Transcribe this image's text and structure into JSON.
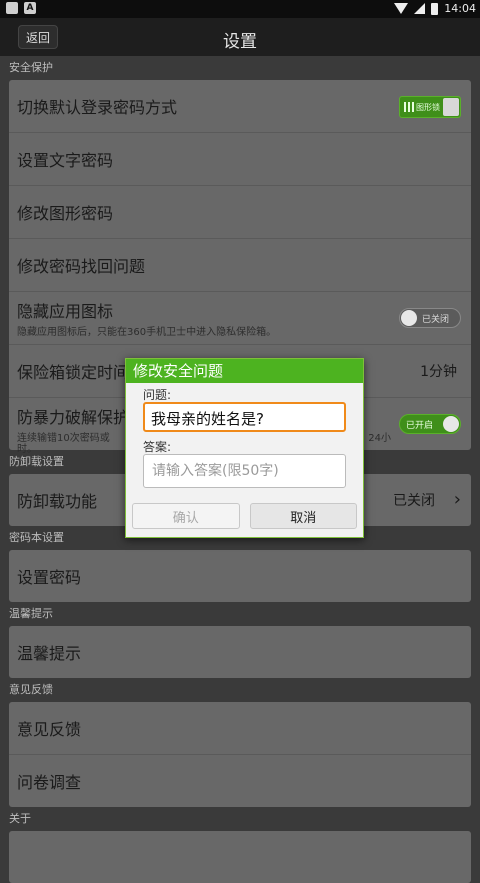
{
  "status": {
    "left_badge": "A",
    "time": "14:04"
  },
  "header": {
    "back_label": "返回",
    "title": "设置"
  },
  "sections": {
    "security": "安全保护",
    "uninstall": "防卸载设置",
    "passbook": "密码本设置",
    "tips": "温馨提示",
    "feedback": "意见反馈",
    "about": "关于"
  },
  "security_rows": {
    "switch_mode": "切换默认登录密码方式",
    "switch_mode_toggle": "图形锁",
    "set_text_password": "设置文字密码",
    "modify_pattern": "修改图形密码",
    "modify_recovery": "修改密码找回问题",
    "hide_icon": "隐藏应用图标",
    "hide_icon_desc": "隐藏应用图标后，只能在360手机卫士中进入隐私保险箱。",
    "hide_icon_toggle": "已关闭",
    "lock_time": "保险箱锁定时间",
    "lock_time_value": "1分钟",
    "brute_force": "防暴力破解保护",
    "brute_force_desc": "连续输错10次密码或",
    "brute_force_desc_tail": "24小",
    "brute_force_desc2": "时。",
    "brute_force_toggle": "已开启"
  },
  "uninstall_rows": {
    "feature": "防卸载功能",
    "status": "已关闭"
  },
  "passbook_rows": {
    "set_password": "设置密码"
  },
  "tips_rows": {
    "tips": "温馨提示"
  },
  "feedback_rows": {
    "feedback": "意见反馈",
    "survey": "问卷调查"
  },
  "dialog": {
    "title": "修改安全问题",
    "question_label": "问题:",
    "question_value": "我母亲的姓名是?",
    "answer_label": "答案:",
    "answer_placeholder": "请输入答案(限50字)",
    "confirm": "确认",
    "cancel": "取消"
  },
  "colors": {
    "accent_green": "#4db320",
    "focus_orange": "#f08a1a"
  }
}
